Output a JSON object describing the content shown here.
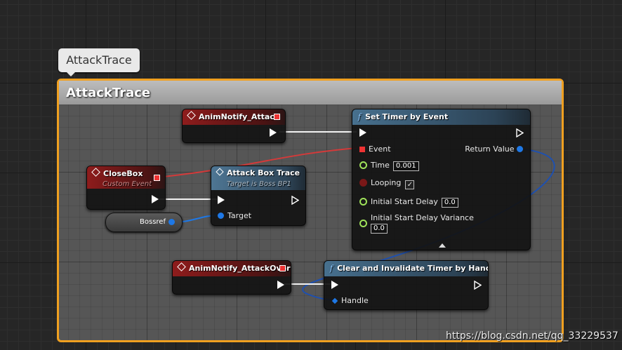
{
  "comment_bubble": "AttackTrace",
  "comment_title": "AttackTrace",
  "nodes": {
    "anim_attack": {
      "title": "AnimNotify_Attack"
    },
    "set_timer": {
      "title": "Set Timer by Event",
      "event_label": "Event",
      "return_label": "Return Value",
      "time_label": "Time",
      "time_value": "0.001",
      "looping_label": "Looping",
      "looping_checked": "✓",
      "delay_label": "Initial Start Delay",
      "delay_value": "0.0",
      "variance_label": "Initial Start Delay Variance",
      "variance_value": "0.0"
    },
    "close_box": {
      "title": "CloseBox",
      "subtitle": "Custom Event"
    },
    "attack_box_trace": {
      "title": "Attack Box Trace",
      "subtitle": "Target is Boss BP1",
      "target_label": "Target"
    },
    "bossref": {
      "label": "Bossref"
    },
    "anim_attack_over": {
      "title": "AnimNotify_AttackOver"
    },
    "clear_timer": {
      "title": "Clear and Invalidate Timer by Handle",
      "handle_label": "Handle"
    }
  },
  "watermark": "https://blog.csdn.net/qq_33229537",
  "colors": {
    "comment_border": "#f0a020",
    "event_header": "#8e1c1c",
    "function_header": "#47708e",
    "delegate_pin": "#e33333",
    "object_pin": "#1e78e6",
    "float_pin": "#9fe25a"
  }
}
